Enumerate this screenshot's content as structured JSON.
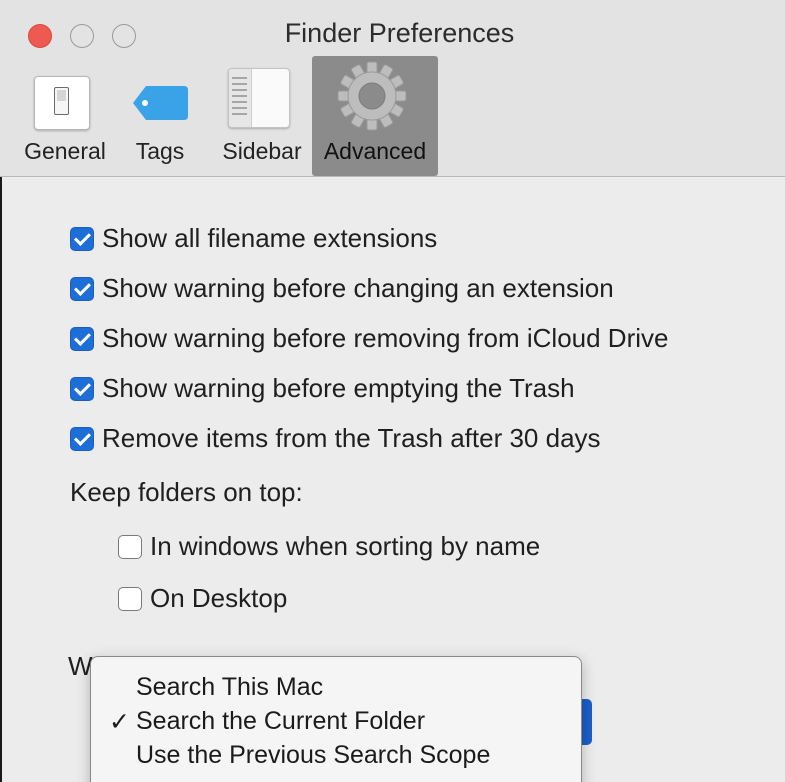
{
  "window": {
    "title": "Finder Preferences"
  },
  "toolbar": {
    "tabs": [
      {
        "label": "General",
        "icon": "general-switch-icon"
      },
      {
        "label": "Tags",
        "icon": "tag-icon"
      },
      {
        "label": "Sidebar",
        "icon": "sidebar-icon"
      },
      {
        "label": "Advanced",
        "icon": "gear-icon",
        "selected": true
      }
    ]
  },
  "advanced": {
    "options": [
      {
        "label": "Show all filename extensions",
        "checked": true
      },
      {
        "label": "Show warning before changing an extension",
        "checked": true
      },
      {
        "label": "Show warning before removing from iCloud Drive",
        "checked": true
      },
      {
        "label": "Show warning before emptying the Trash",
        "checked": true
      },
      {
        "label": "Remove items from the Trash after 30 days",
        "checked": true
      }
    ],
    "keep_folders_label": "Keep folders on top:",
    "keep_folders": [
      {
        "label": "In windows when sorting by name",
        "checked": false
      },
      {
        "label": "On Desktop",
        "checked": false
      }
    ],
    "search_label_partial": "W"
  },
  "search_menu": {
    "items": [
      {
        "label": "Search This Mac",
        "checkmark": ""
      },
      {
        "label": "Search the Current Folder",
        "checkmark": "✓"
      },
      {
        "label": "Use the Previous Search Scope",
        "checkmark": ""
      }
    ]
  },
  "colors": {
    "accent": "#1e6ed8",
    "close": "#ee5a52",
    "tag": "#3aa3e8",
    "selected_tab": "#8b8b8b"
  }
}
